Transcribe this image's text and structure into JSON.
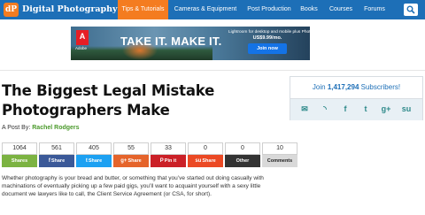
{
  "site": {
    "logo_letters": "dP",
    "name": "Digital Photography School"
  },
  "nav": {
    "items": [
      {
        "label": "Tips & Tutorials",
        "active": true
      },
      {
        "label": "Cameras & Equipment",
        "active": false
      },
      {
        "label": "Post Production",
        "active": false
      },
      {
        "label": "Books",
        "active": false
      },
      {
        "label": "Courses",
        "active": false
      },
      {
        "label": "Forums",
        "active": false
      }
    ],
    "search_icon": "search-icon",
    "bar_color": "#1d6fb7",
    "active_color": "#f47c20"
  },
  "ad": {
    "brand_mark": "A",
    "brand_word": "Adobe",
    "headline": "TAKE IT.  MAKE IT.",
    "copy_line1": "Lightroom for desktop and mobile plus Photoshop CC",
    "copy_line2": "US$9.99/mo.",
    "cta": "Join now"
  },
  "article": {
    "title": "The Biggest Legal Mistake Photographers Make",
    "byline_prefix": "A Post By: ",
    "author": "Rachel Rodgers",
    "body": "Whether photography is your bread and butter, or something that you’ve started out doing casually with machinations of eventually picking up a few paid gigs, you’ll want to acquaint yourself with a sexy little document we lawyers like to call, the Client Service Agreement (or CSA, for short)."
  },
  "share_bar": [
    {
      "count": "1064",
      "label": "Shares",
      "icon": "",
      "color": "#7cb342",
      "text_color": "#ffffff"
    },
    {
      "count": "561",
      "label": "Share",
      "icon": "f",
      "color": "#3b5998",
      "text_color": "#ffffff"
    },
    {
      "count": "405",
      "label": "Share",
      "icon": "t",
      "color": "#1da1f2",
      "text_color": "#ffffff"
    },
    {
      "count": "55",
      "label": "Share",
      "icon": "g+",
      "color": "#e5642b",
      "text_color": "#ffffff"
    },
    {
      "count": "33",
      "label": "Pin it",
      "icon": "P",
      "color": "#cb2027",
      "text_color": "#ffffff"
    },
    {
      "count": "0",
      "label": "Share",
      "icon": "su",
      "color": "#eb4924",
      "text_color": "#ffffff"
    },
    {
      "count": "0",
      "label": "Other",
      "icon": "",
      "color": "#333333",
      "text_color": "#ffffff"
    },
    {
      "count": "10",
      "label": "Comments",
      "icon": "",
      "color": "#d9d9d9",
      "text_color": "#222222"
    }
  ],
  "sidebar": {
    "join_prefix": "Join ",
    "subscriber_count": "1,417,294",
    "join_suffix": " Subscribers!",
    "icons": [
      "email-icon",
      "rss-icon",
      "facebook-icon",
      "twitter-icon",
      "google-plus-icon",
      "stumbleupon-icon"
    ],
    "icon_glyphs": [
      "✉",
      "◝",
      "f",
      "t",
      "g+",
      "su"
    ]
  }
}
